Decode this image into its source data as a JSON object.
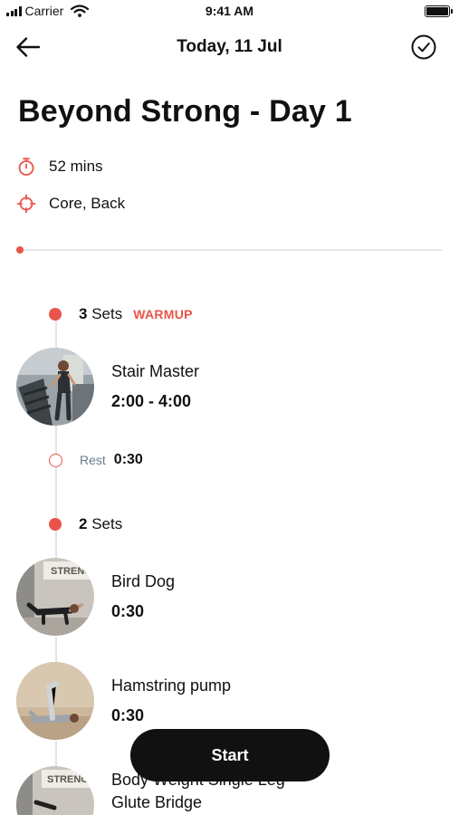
{
  "status_bar": {
    "carrier": "Carrier",
    "time": "9:41 AM"
  },
  "nav": {
    "back_icon": "arrow-left-icon",
    "title": "Today, 11 Jul",
    "complete_icon": "check-circle-icon"
  },
  "workout": {
    "title": "Beyond Strong - Day 1",
    "duration": "52 mins",
    "duration_icon": "stopwatch-icon",
    "muscles": "Core, Back",
    "muscles_icon": "crosshair-icon",
    "progress_percent": 0
  },
  "groups": [
    {
      "sets_number": "3",
      "sets_word": "Sets",
      "tag": "WARMUP",
      "exercises": [
        {
          "name": "Stair Master",
          "duration": "2:00 - 4:00"
        }
      ],
      "rest": {
        "label": "Rest",
        "value": "0:30"
      }
    },
    {
      "sets_number": "2",
      "sets_word": "Sets",
      "exercises": [
        {
          "name": "Bird Dog",
          "duration": "0:30"
        },
        {
          "name": "Hamstring pump",
          "duration": "0:30"
        },
        {
          "name_line1": "Body Weight Single Leg",
          "name_line2": "Glute Bridge"
        }
      ]
    }
  ],
  "start_button": {
    "label": "Start"
  },
  "colors": {
    "accent": "#e8544a",
    "text": "#111111",
    "muted": "#6b7a8f",
    "button_bg": "#111111"
  }
}
